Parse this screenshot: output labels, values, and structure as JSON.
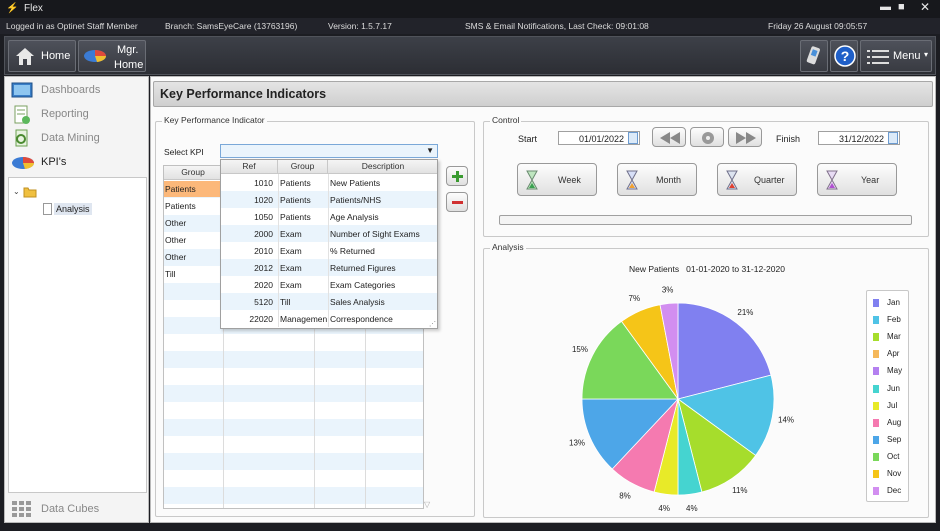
{
  "app": {
    "title": "Flex"
  },
  "status": {
    "logged_in": "Logged in as Optinet Staff Member",
    "branch": "Branch: SamsEyeCare (13763196)",
    "version": "Version: 1.5.7.17",
    "notifications": "SMS & Email Notifications, Last Check: 09:01:08",
    "datetime": "Friday 26 August 09:05:57"
  },
  "nav": {
    "home": "Home",
    "mgr_home_1": "Mgr.",
    "mgr_home_2": "Home",
    "menu": "Menu"
  },
  "sidebar": {
    "items": [
      {
        "label": "Dashboards"
      },
      {
        "label": "Reporting"
      },
      {
        "label": "Data Mining"
      },
      {
        "label": "KPI's"
      }
    ],
    "tree_child": "Analysis",
    "bottom": "Data Cubes"
  },
  "page": {
    "title": "Key Performance Indicators"
  },
  "kpi_panel": {
    "group_label": "Key Performance Indicator",
    "select_label": "Select KPI",
    "left_header": "Group",
    "left_rows": [
      "Patients",
      "Patients",
      "Other",
      "Other",
      "Other",
      "Till"
    ],
    "dropdown_headers": [
      "Ref",
      "Group",
      "Description"
    ],
    "dropdown_rows": [
      [
        "1010",
        "Patients",
        "New Patients"
      ],
      [
        "1020",
        "Patients",
        "Patients/NHS"
      ],
      [
        "1050",
        "Patients",
        "Age Analysis"
      ],
      [
        "2000",
        "Exam",
        "Number of Sight Exams"
      ],
      [
        "2010",
        "Exam",
        "% Returned"
      ],
      [
        "2012",
        "Exam",
        "Returned Figures"
      ],
      [
        "2020",
        "Exam",
        "Exam Categories"
      ],
      [
        "5120",
        "Till",
        "Sales Analysis"
      ],
      [
        "22020",
        "Managemen",
        "Correspondence"
      ]
    ]
  },
  "control": {
    "group_label": "Control",
    "start_label": "Start",
    "start_value": "01/01/2022",
    "finish_label": "Finish",
    "finish_value": "31/12/2022",
    "periods": [
      "Week",
      "Month",
      "Quarter",
      "Year"
    ]
  },
  "analysis": {
    "group_label": "Analysis"
  },
  "chart_data": {
    "type": "pie",
    "title": "New Patients   01-01-2020 to 31-12-2020",
    "categories": [
      "Jan",
      "Feb",
      "Mar",
      "Apr",
      "May",
      "Jun",
      "Jul",
      "Aug",
      "Sep",
      "Oct",
      "Nov",
      "Dec"
    ],
    "values": [
      21,
      14,
      11,
      4,
      4,
      8,
      13,
      15,
      7,
      3
    ],
    "slice_months": [
      "Jan",
      "Feb",
      "Mar",
      "Jun",
      "Jul",
      "Aug",
      "Sep",
      "Oct",
      "Nov",
      "Dec"
    ],
    "labels": [
      "21%",
      "14%",
      "11%",
      "4%",
      "4%",
      "8%",
      "13%",
      "15%",
      "7%",
      "3%"
    ],
    "colors": {
      "Jan": "#8080f0",
      "Feb": "#4fc3e6",
      "Mar": "#a6dd2c",
      "Apr": "#f5b85a",
      "May": "#b480f0",
      "Jun": "#45d4d0",
      "Jul": "#e8ea28",
      "Aug": "#f57ab0",
      "Sep": "#4da6e8",
      "Oct": "#7ad85a",
      "Nov": "#f5c518",
      "Dec": "#d28ef0"
    },
    "legend_position": "right"
  }
}
